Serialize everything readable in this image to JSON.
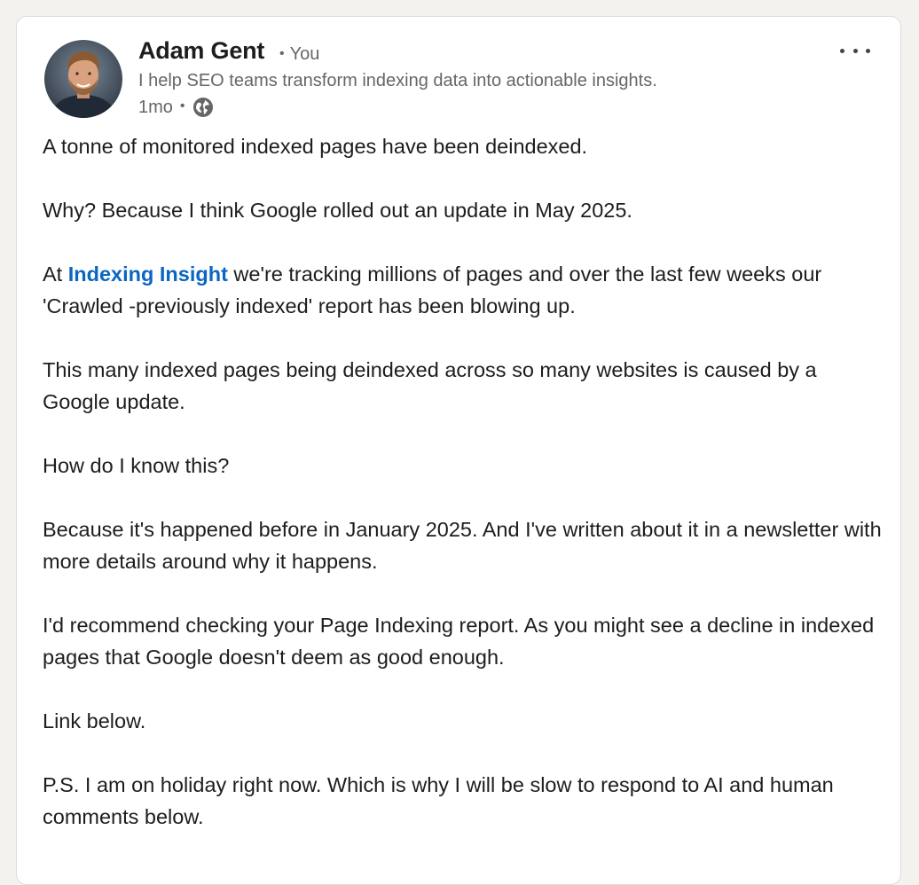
{
  "author": {
    "name": "Adam Gent",
    "relation": "You",
    "headline": "I help SEO teams transform indexing data into actionable insights.",
    "time": "1mo",
    "visibility_icon": "globe-icon"
  },
  "menu": {
    "icon": "more-horizontal-icon"
  },
  "post": {
    "p1": "A tonne of monitored indexed pages have been deindexed.",
    "p2": "Why? Because I think Google rolled out an update in May 2025.",
    "p3_before": "At ",
    "p3_mention": "Indexing Insight",
    "p3_after": " we're tracking millions of pages and over the last few weeks our 'Crawled -previously indexed' report has been blowing up.",
    "p4": "This many indexed pages being deindexed across so many websites is caused by a Google update.",
    "p5": "How do I know this?",
    "p6": "Because it's happened before in January 2025. And I've written about it in a newsletter with more details around why it happens.",
    "p7": "I'd recommend checking your Page Indexing report. As you might see a decline in indexed pages that Google doesn't deem as good enough.",
    "p8": "Link below.",
    "p9": "P.S. I am on holiday right now. Which is why I will be slow to respond to AI and human comments below."
  },
  "colors": {
    "mention": "#0a66c2",
    "secondary_text": "#666666",
    "background": "#f3f2ef"
  }
}
